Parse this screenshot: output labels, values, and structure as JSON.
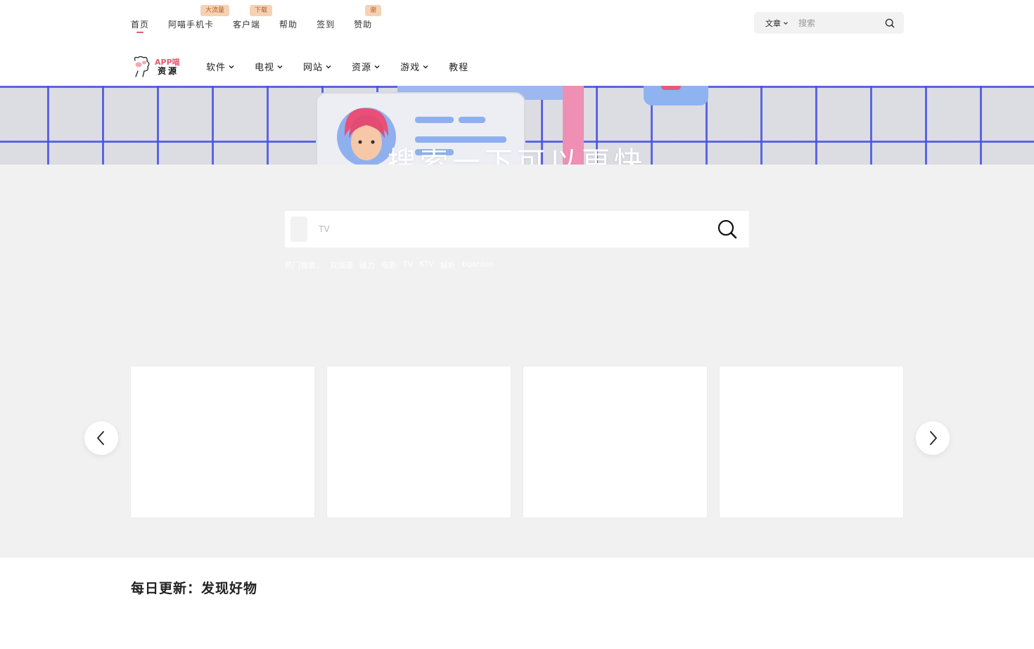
{
  "top_nav": {
    "items": [
      {
        "label": "首页",
        "active": true
      },
      {
        "label": "阿喵手机卡",
        "badge": "大流量"
      },
      {
        "label": "客户端",
        "badge": "下载"
      },
      {
        "label": "帮助"
      },
      {
        "label": "签到"
      },
      {
        "label": "赞助",
        "badge": "谢"
      }
    ]
  },
  "top_search": {
    "category": "文章",
    "placeholder": "搜索"
  },
  "logo": {
    "top": "APP喵",
    "bottom": "资源"
  },
  "main_nav": {
    "items": [
      {
        "label": "软件",
        "has_dropdown": true
      },
      {
        "label": "电视",
        "has_dropdown": true
      },
      {
        "label": "网站",
        "has_dropdown": true
      },
      {
        "label": "资源",
        "has_dropdown": true
      },
      {
        "label": "游戏",
        "has_dropdown": true
      },
      {
        "label": "教程",
        "has_dropdown": false
      }
    ]
  },
  "hero": {
    "title": "搜索一下可以更快"
  },
  "search": {
    "placeholder": "TV",
    "hot_label": "热门搜索：",
    "hot_terms": [
      "双端漫",
      "磁力",
      "电影",
      "TV",
      "KTV",
      "解析",
      "bgarden"
    ]
  },
  "carousel": {
    "card_count": 4,
    "prev_icon": "chevron-left-icon",
    "next_icon": "chevron-right-icon"
  },
  "section": {
    "title": "每日更新：发现好物"
  },
  "colors": {
    "accent": "#e25b6f",
    "badge_bg": "#f6d2b4",
    "page_gray": "#f1f1f1"
  }
}
